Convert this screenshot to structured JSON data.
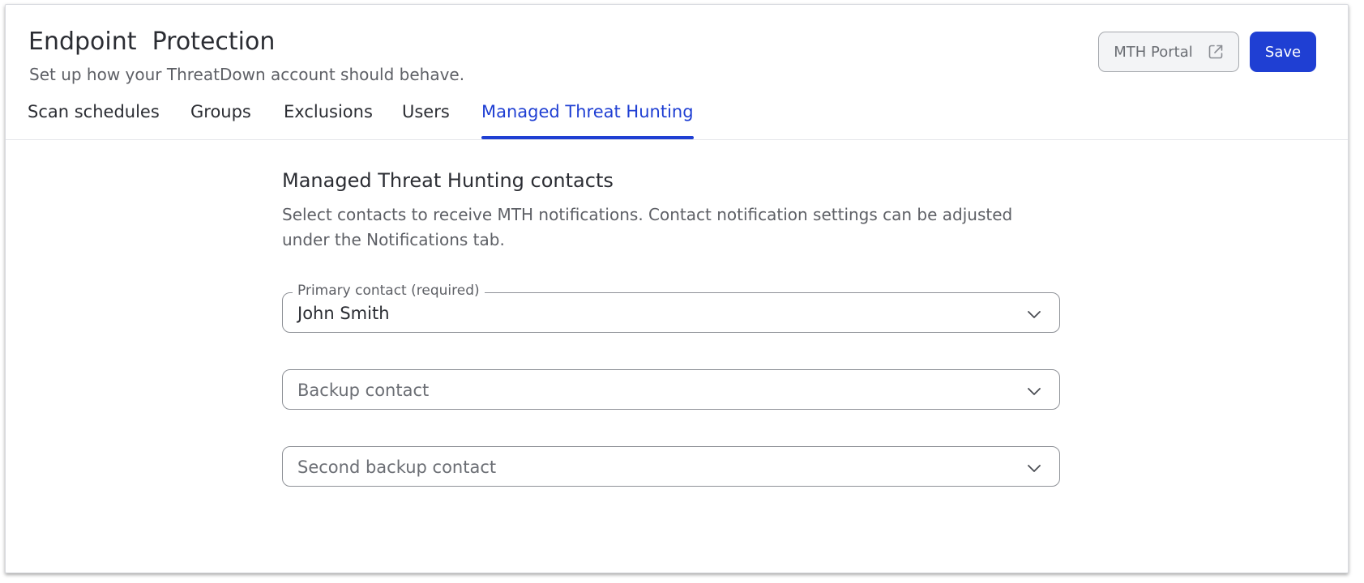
{
  "header": {
    "title": "Endpoint  Protection",
    "subtitle": "Set up how your ThreatDown account should behave.",
    "portal_label": "MTH Portal",
    "save_label": "Save"
  },
  "tabs": [
    {
      "label": "Scan schedules",
      "active": false
    },
    {
      "label": "Groups",
      "active": false
    },
    {
      "label": "Exclusions",
      "active": false
    },
    {
      "label": "Users",
      "active": false
    },
    {
      "label": "Managed Threat Hunting",
      "active": true
    }
  ],
  "section": {
    "title": "Managed Threat Hunting contacts",
    "description": "Select contacts to receive MTH notifications. Contact notification settings can be adjusted under the Notifications tab."
  },
  "fields": {
    "primary": {
      "label": "Primary contact (required)",
      "value": "John Smith"
    },
    "backup": {
      "placeholder": "Backup contact"
    },
    "second_backup": {
      "placeholder": "Second backup contact"
    }
  },
  "icons": {
    "portal": "external-link-icon",
    "dropdown": "chevron-down-icon"
  },
  "colors": {
    "accent": "#1f3fd3",
    "text": "#2b2d33",
    "muted": "#5e6066",
    "border": "#8e9197"
  }
}
